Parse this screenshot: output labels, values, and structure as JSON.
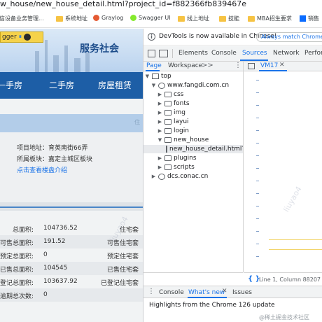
{
  "browser": {
    "url": "w_house/new_house_detail.html?project_id=f882366fb839467e",
    "bookmarks": [
      {
        "label": "宏信设备业务管理...",
        "icon": "red-icon"
      },
      {
        "label": "系统地址",
        "icon": "folder-icon"
      },
      {
        "label": "Graylog",
        "icon": "graylog-icon"
      },
      {
        "label": "Swagger UI",
        "icon": "swagger-icon"
      },
      {
        "label": "线上地址",
        "icon": "folder-icon"
      },
      {
        "label": "技能",
        "icon": "folder-icon"
      },
      {
        "label": "MBA招生要求",
        "icon": "folder-icon"
      },
      {
        "label": "销售",
        "icon": "blue-icon"
      }
    ]
  },
  "site": {
    "swagger_tag": "gger",
    "service_title": "服务社会",
    "nav": [
      "一手房",
      "二手房",
      "房屋租赁"
    ],
    "address_label": "项目地址：",
    "address_value": "育英南街66弄",
    "region_label": "所属板块：",
    "region_value": "嘉定主城区板块",
    "map_link": "点击查看楼盘介绍",
    "location_hint": "住",
    "stats": [
      {
        "label": "总面积:",
        "value": "104736.52",
        "right": "住宅套"
      },
      {
        "label": "可售总面积:",
        "value": "191.52",
        "right": "可售住宅套"
      },
      {
        "label": "预定总面积:",
        "value": "0",
        "right": "预定住宅套"
      },
      {
        "label": "已售总面积:",
        "value": "104545",
        "right": "已售住宅套"
      },
      {
        "label": "已登记总面积:",
        "value": "103637.92",
        "right": "已登记住宅套"
      },
      {
        "label": "逾期总次数:",
        "value": "0",
        "right": ""
      }
    ]
  },
  "devtools": {
    "info_text": "DevTools is now available in Chinese!",
    "match_button": "Always match Chrome's la",
    "tabs": [
      "Elements",
      "Console",
      "Sources",
      "Network",
      "Perform"
    ],
    "active_tab": "Sources",
    "navigator_tabs": [
      "Page",
      "Workspace"
    ],
    "more_label": ">>",
    "tree": [
      {
        "label": "top",
        "level": 0,
        "type": "frame",
        "expanded": true
      },
      {
        "label": "www.fangdi.com.cn",
        "level": 1,
        "type": "cloud",
        "expanded": true
      },
      {
        "label": "css",
        "level": 2,
        "type": "folder",
        "expanded": false
      },
      {
        "label": "fonts",
        "level": 2,
        "type": "folder",
        "expanded": false
      },
      {
        "label": "img",
        "level": 2,
        "type": "folder",
        "expanded": false
      },
      {
        "label": "layui",
        "level": 2,
        "type": "folder",
        "expanded": false
      },
      {
        "label": "login",
        "level": 2,
        "type": "folder",
        "expanded": false
      },
      {
        "label": "new_house",
        "level": 2,
        "type": "folder",
        "expanded": true
      },
      {
        "label": "new_house_detail.html?pr",
        "level": 3,
        "type": "file",
        "expanded": false
      },
      {
        "label": "plugins",
        "level": 2,
        "type": "folder",
        "expanded": false
      },
      {
        "label": "scripts",
        "level": 2,
        "type": "folder",
        "expanded": false
      },
      {
        "label": "dcs.conac.cn",
        "level": 1,
        "type": "cloud",
        "expanded": false
      }
    ],
    "editor_tab": "VM17",
    "cursor_position": "Line 1, Column 88207",
    "drawer_tabs": [
      "Console",
      "What's new",
      "Issues"
    ],
    "drawer_active": "What's new",
    "drawer_text": "Highlights from the Chrome 126 update",
    "credit": "@稀土掘金技术社区"
  },
  "watermark": "liuyao4",
  "colors": {
    "accent": "#1a73e8",
    "site_nav": "#1d5ea6",
    "site_title": "#1c4c8a"
  }
}
